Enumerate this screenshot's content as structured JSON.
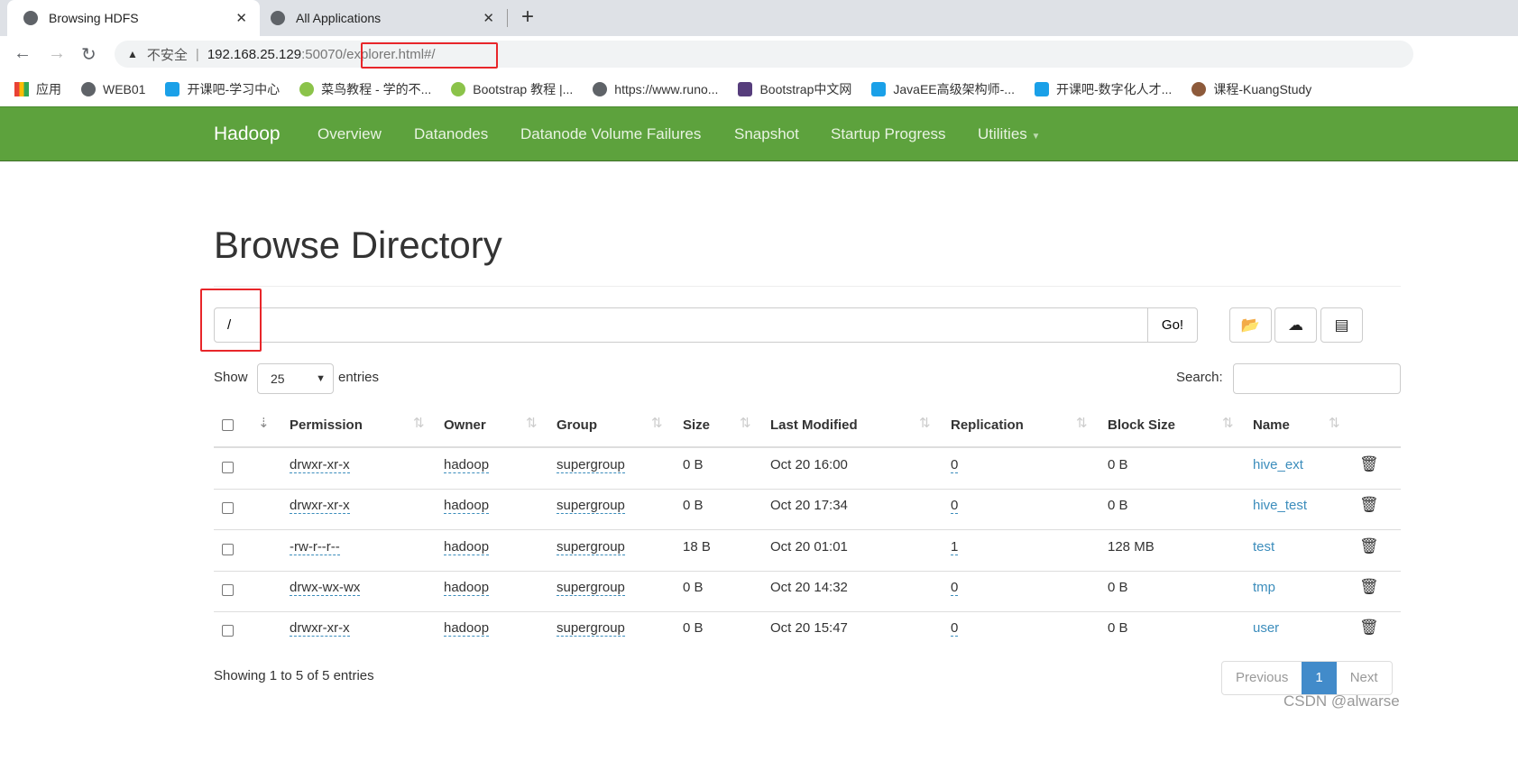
{
  "browser": {
    "tabs": [
      {
        "title": "Browsing HDFS",
        "active": true
      },
      {
        "title": "All Applications",
        "active": false
      }
    ],
    "new_tab": "+",
    "security": "不安全",
    "url_host": "192.168.25.129",
    "url_port": ":50070",
    "url_path": "/explorer.html#/",
    "bookmarks": [
      "应用",
      "WEB01",
      "开课吧-学习中心",
      "菜鸟教程 - 学的不...",
      "Bootstrap 教程 |...",
      "https://www.runo...",
      "Bootstrap中文网",
      "JavaEE高级架构师-...",
      "开课吧-数字化人才...",
      "课程-KuangStudy"
    ]
  },
  "navbar": {
    "brand": "Hadoop",
    "items": [
      "Overview",
      "Datanodes",
      "Datanode Volume Failures",
      "Snapshot",
      "Startup Progress",
      "Utilities"
    ],
    "color": "#5da23d"
  },
  "page": {
    "title": "Browse Directory",
    "path_value": "/",
    "go_label": "Go!",
    "show_label": "Show",
    "entries_value": "25",
    "entries_label": "entries",
    "search_label": "Search:",
    "columns": [
      "Permission",
      "Owner",
      "Group",
      "Size",
      "Last Modified",
      "Replication",
      "Block Size",
      "Name"
    ],
    "rows": [
      [
        "drwxr-xr-x",
        "hadoop",
        "supergroup",
        "0 B",
        "Oct 20 16:00",
        "0",
        "0 B",
        "hive_ext"
      ],
      [
        "drwxr-xr-x",
        "hadoop",
        "supergroup",
        "0 B",
        "Oct 20 17:34",
        "0",
        "0 B",
        "hive_test"
      ],
      [
        "-rw-r--r--",
        "hadoop",
        "supergroup",
        "18 B",
        "Oct 20 01:01",
        "1",
        "128 MB",
        "test"
      ],
      [
        "drwx-wx-wx",
        "hadoop",
        "supergroup",
        "0 B",
        "Oct 20 14:32",
        "0",
        "0 B",
        "tmp"
      ],
      [
        "drwxr-xr-x",
        "hadoop",
        "supergroup",
        "0 B",
        "Oct 20 15:47",
        "0",
        "0 B",
        "user"
      ]
    ],
    "info": "Showing 1 to 5 of 5 entries",
    "pagination": {
      "previous": "Previous",
      "current": "1",
      "next": "Next"
    }
  },
  "watermark": "CSDN @alwarse"
}
